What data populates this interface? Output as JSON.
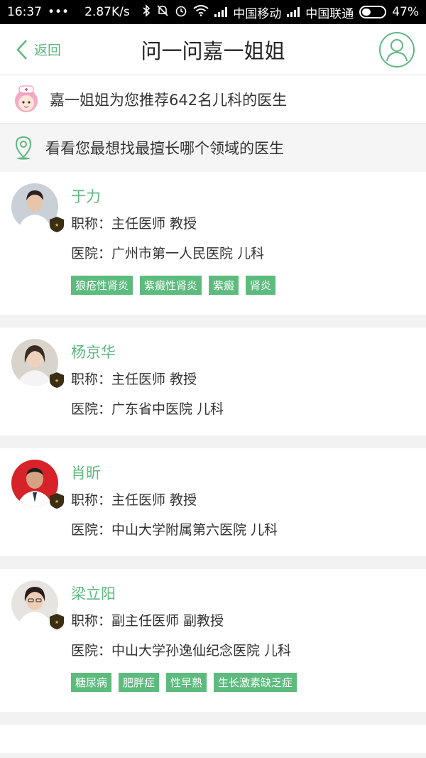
{
  "status": {
    "time": "16:37",
    "dots": "•••",
    "speed": "2.87K/s",
    "carrier1": "中国移动",
    "carrier2": "中国联通",
    "battery_pct": "47%",
    "battery_level": 0.47
  },
  "nav": {
    "back_label": "返回",
    "title": "问一问嘉一姐姐"
  },
  "banner": {
    "text": "嘉一姐姐为您推荐642名儿科的医生"
  },
  "hint": {
    "text": "看看您最想找最擅长哪个领域的医生"
  },
  "doctors": [
    {
      "name": "于力",
      "title_line": "职称：主任医师 教授",
      "hospital_line": "医院：广州市第一人民医院 儿科",
      "tags": [
        "狼疮性肾炎",
        "紫癜性肾炎",
        "紫癜",
        "肾炎"
      ]
    },
    {
      "name": "杨京华",
      "title_line": "职称：主任医师 教授",
      "hospital_line": "医院：广东省中医院 儿科",
      "tags": []
    },
    {
      "name": "肖昕",
      "title_line": "职称：主任医师 教授",
      "hospital_line": "医院：中山大学附属第六医院 儿科",
      "tags": []
    },
    {
      "name": "梁立阳",
      "title_line": "职称：副主任医师 副教授",
      "hospital_line": "医院：中山大学孙逸仙纪念医院 儿科",
      "tags": [
        "糖尿病",
        "肥胖症",
        "性早熟",
        "生长激素缺乏症"
      ]
    }
  ],
  "colors": {
    "accent": "#5db87f",
    "tag_bg": "#5dbb7e"
  }
}
